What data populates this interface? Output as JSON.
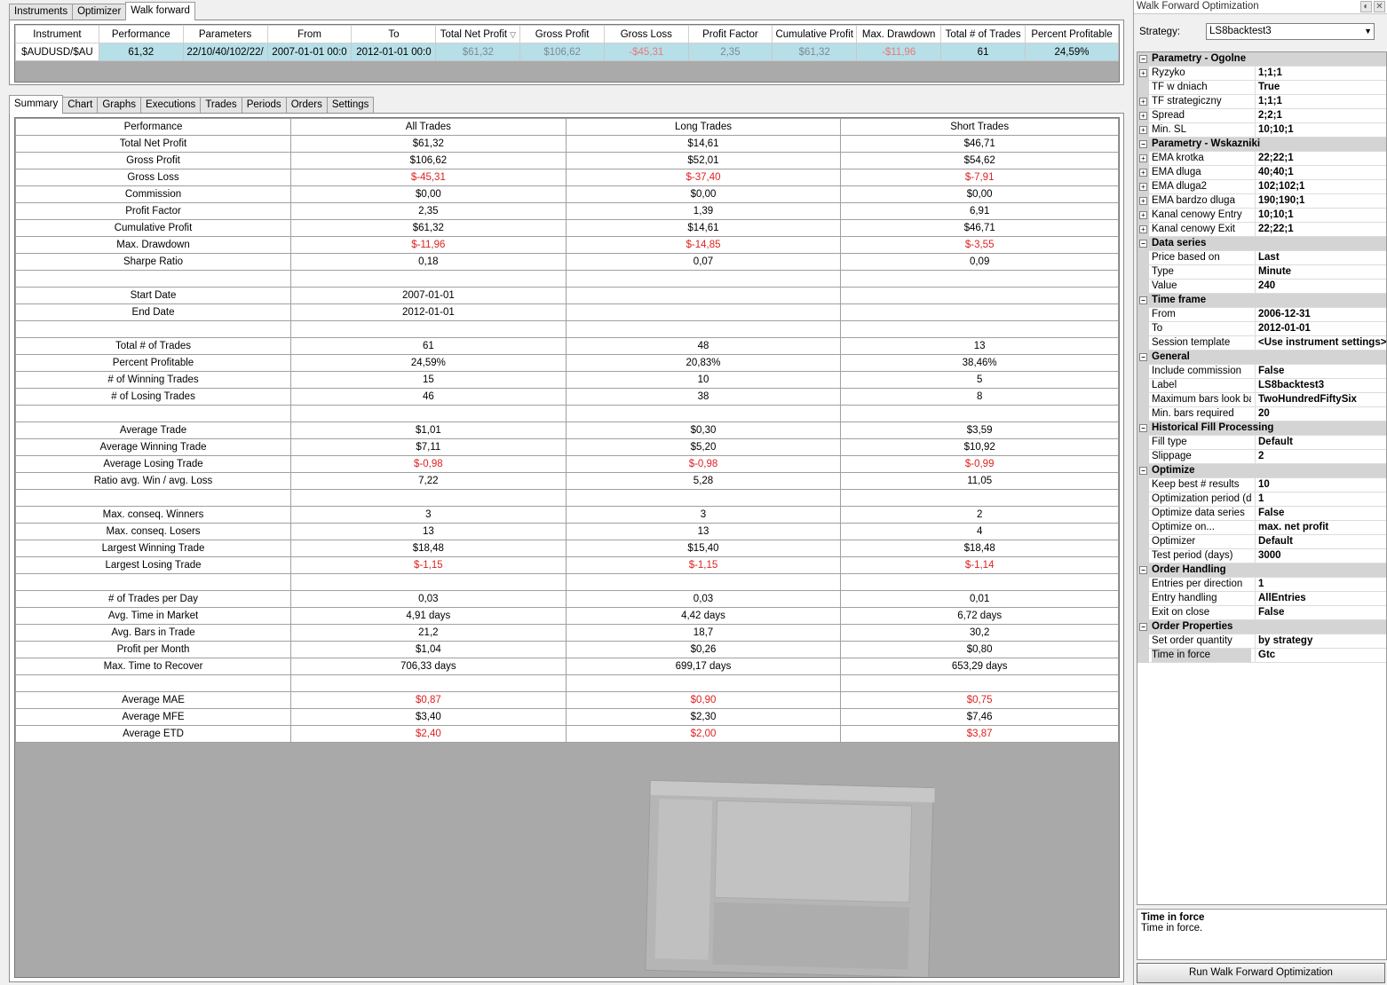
{
  "top_tabs": [
    "Instruments",
    "Optimizer",
    "Walk forward"
  ],
  "top_grid": {
    "headers": [
      "Instrument",
      "Performance",
      "Parameters",
      "From",
      "To",
      "Total Net Profit",
      "Gross Profit",
      "Gross Loss",
      "Profit Factor",
      "Cumulative Profit",
      "Max. Drawdown",
      "Total # of Trades",
      "Percent Profitable"
    ],
    "sort_indicator": "▽",
    "row": [
      "$AUDUSD/$AU",
      "61,32",
      "22/10/40/102/22/",
      "2007-01-01 00:0",
      "2012-01-01 00:0",
      "$61,32",
      "$106,62",
      "-$45,31",
      "2,35",
      "$61,32",
      "-$11,96",
      "61",
      "24,59%"
    ]
  },
  "lower_tabs": [
    "Summary",
    "Chart",
    "Graphs",
    "Executions",
    "Trades",
    "Periods",
    "Orders",
    "Settings"
  ],
  "summary": {
    "headers": [
      "Performance",
      "All Trades",
      "Long Trades",
      "Short Trades"
    ],
    "rows": [
      {
        "label": "Total Net Profit",
        "all": "$61,32",
        "long": "$14,61",
        "short": "$46,71"
      },
      {
        "label": "Gross Profit",
        "all": "$106,62",
        "long": "$52,01",
        "short": "$54,62"
      },
      {
        "label": "Gross Loss",
        "all": "$-45,31",
        "long": "$-37,40",
        "short": "$-7,91",
        "neg": true
      },
      {
        "label": "Commission",
        "all": "$0,00",
        "long": "$0,00",
        "short": "$0,00"
      },
      {
        "label": "Profit Factor",
        "all": "2,35",
        "long": "1,39",
        "short": "6,91"
      },
      {
        "label": "Cumulative Profit",
        "all": "$61,32",
        "long": "$14,61",
        "short": "$46,71"
      },
      {
        "label": "Max. Drawdown",
        "all": "$-11,96",
        "long": "$-14,85",
        "short": "$-3,55",
        "neg": true
      },
      {
        "label": "Sharpe Ratio",
        "all": "0,18",
        "long": "0,07",
        "short": "0,09"
      },
      {
        "label": "",
        "all": "",
        "long": "",
        "short": ""
      },
      {
        "label": "Start Date",
        "all": "2007-01-01",
        "long": "",
        "short": ""
      },
      {
        "label": "End Date",
        "all": "2012-01-01",
        "long": "",
        "short": ""
      },
      {
        "label": "",
        "all": "",
        "long": "",
        "short": ""
      },
      {
        "label": "Total # of Trades",
        "all": "61",
        "long": "48",
        "short": "13"
      },
      {
        "label": "Percent Profitable",
        "all": "24,59%",
        "long": "20,83%",
        "short": "38,46%"
      },
      {
        "label": "# of Winning Trades",
        "all": "15",
        "long": "10",
        "short": "5"
      },
      {
        "label": "# of Losing Trades",
        "all": "46",
        "long": "38",
        "short": "8"
      },
      {
        "label": "",
        "all": "",
        "long": "",
        "short": ""
      },
      {
        "label": "Average Trade",
        "all": "$1,01",
        "long": "$0,30",
        "short": "$3,59"
      },
      {
        "label": "Average Winning Trade",
        "all": "$7,11",
        "long": "$5,20",
        "short": "$10,92"
      },
      {
        "label": "Average Losing Trade",
        "all": "$-0,98",
        "long": "$-0,98",
        "short": "$-0,99",
        "neg": true
      },
      {
        "label": "Ratio avg. Win / avg. Loss",
        "all": "7,22",
        "long": "5,28",
        "short": "11,05"
      },
      {
        "label": "",
        "all": "",
        "long": "",
        "short": ""
      },
      {
        "label": "Max. conseq. Winners",
        "all": "3",
        "long": "3",
        "short": "2"
      },
      {
        "label": "Max. conseq. Losers",
        "all": "13",
        "long": "13",
        "short": "4"
      },
      {
        "label": "Largest Winning Trade",
        "all": "$18,48",
        "long": "$15,40",
        "short": "$18,48"
      },
      {
        "label": "Largest Losing Trade",
        "all": "$-1,15",
        "long": "$-1,15",
        "short": "$-1,14",
        "neg": true
      },
      {
        "label": "",
        "all": "",
        "long": "",
        "short": ""
      },
      {
        "label": "# of Trades per Day",
        "all": "0,03",
        "long": "0,03",
        "short": "0,01"
      },
      {
        "label": "Avg. Time in Market",
        "all": "4,91 days",
        "long": "4,42 days",
        "short": "6,72 days"
      },
      {
        "label": "Avg. Bars in Trade",
        "all": "21,2",
        "long": "18,7",
        "short": "30,2"
      },
      {
        "label": "Profit per Month",
        "all": "$1,04",
        "long": "$0,26",
        "short": "$0,80"
      },
      {
        "label": "Max. Time to Recover",
        "all": "706,33 days",
        "long": "699,17 days",
        "short": "653,29 days"
      },
      {
        "label": "",
        "all": "",
        "long": "",
        "short": ""
      },
      {
        "label": "Average MAE",
        "all": "$0,87",
        "long": "$0,90",
        "short": "$0,75",
        "neg": true
      },
      {
        "label": "Average MFE",
        "all": "$3,40",
        "long": "$2,30",
        "short": "$7,46"
      },
      {
        "label": "Average ETD",
        "all": "$2,40",
        "long": "$2,00",
        "short": "$3,87",
        "neg": true
      }
    ]
  },
  "right_panel": {
    "title": "Walk Forward Optimization",
    "strategy_label": "Strategy:",
    "strategy_value": "LS8backtest3",
    "properties": [
      {
        "type": "cat",
        "name": "Parametry - Ogolne"
      },
      {
        "type": "prop",
        "name": "Ryzyko",
        "value": "1;1;1",
        "expandable": true
      },
      {
        "type": "prop",
        "name": "TF w dniach",
        "value": "True"
      },
      {
        "type": "prop",
        "name": "TF strategiczny",
        "value": "1;1;1",
        "expandable": true
      },
      {
        "type": "prop",
        "name": "Spread",
        "value": "2;2;1",
        "expandable": true
      },
      {
        "type": "prop",
        "name": "Min. SL",
        "value": "10;10;1",
        "expandable": true
      },
      {
        "type": "cat",
        "name": "Parametry - Wskazniki"
      },
      {
        "type": "prop",
        "name": "EMA krotka",
        "value": "22;22;1",
        "expandable": true
      },
      {
        "type": "prop",
        "name": "EMA dluga",
        "value": "40;40;1",
        "expandable": true
      },
      {
        "type": "prop",
        "name": "EMA dluga2",
        "value": "102;102;1",
        "expandable": true
      },
      {
        "type": "prop",
        "name": "EMA bardzo dluga",
        "value": "190;190;1",
        "expandable": true
      },
      {
        "type": "prop",
        "name": "Kanal cenowy Entry",
        "value": "10;10;1",
        "expandable": true
      },
      {
        "type": "prop",
        "name": "Kanal cenowy Exit",
        "value": "22;22;1",
        "expandable": true
      },
      {
        "type": "cat",
        "name": "Data series"
      },
      {
        "type": "prop",
        "name": "Price based on",
        "value": "Last"
      },
      {
        "type": "prop",
        "name": "Type",
        "value": "Minute"
      },
      {
        "type": "prop",
        "name": "Value",
        "value": "240"
      },
      {
        "type": "cat",
        "name": "Time frame"
      },
      {
        "type": "prop",
        "name": "From",
        "value": "2006-12-31"
      },
      {
        "type": "prop",
        "name": "To",
        "value": "2012-01-01"
      },
      {
        "type": "prop",
        "name": "Session template",
        "value": "<Use instrument settings>"
      },
      {
        "type": "cat",
        "name": "General"
      },
      {
        "type": "prop",
        "name": "Include commission",
        "value": "False"
      },
      {
        "type": "prop",
        "name": "Label",
        "value": "LS8backtest3"
      },
      {
        "type": "prop",
        "name": "Maximum bars look bac",
        "value": "TwoHundredFiftySix"
      },
      {
        "type": "prop",
        "name": "Min. bars required",
        "value": "20"
      },
      {
        "type": "cat",
        "name": "Historical Fill Processing"
      },
      {
        "type": "prop",
        "name": "Fill type",
        "value": "Default"
      },
      {
        "type": "prop",
        "name": "Slippage",
        "value": "2"
      },
      {
        "type": "cat",
        "name": "Optimize"
      },
      {
        "type": "prop",
        "name": "Keep best # results",
        "value": "10"
      },
      {
        "type": "prop",
        "name": "Optimization period (da",
        "value": "1"
      },
      {
        "type": "prop",
        "name": "Optimize data series",
        "value": "False"
      },
      {
        "type": "prop",
        "name": "Optimize on...",
        "value": "max. net profit"
      },
      {
        "type": "prop",
        "name": "Optimizer",
        "value": "Default"
      },
      {
        "type": "prop",
        "name": "Test period (days)",
        "value": "3000"
      },
      {
        "type": "cat",
        "name": "Order Handling"
      },
      {
        "type": "prop",
        "name": "Entries per direction",
        "value": "1"
      },
      {
        "type": "prop",
        "name": "Entry handling",
        "value": "AllEntries"
      },
      {
        "type": "prop",
        "name": "Exit on close",
        "value": "False"
      },
      {
        "type": "cat",
        "name": "Order Properties"
      },
      {
        "type": "prop",
        "name": "Set order quantity",
        "value": "by strategy"
      },
      {
        "type": "prop",
        "name": "Time in force",
        "value": "Gtc",
        "selected": true
      }
    ],
    "help_title": "Time in force",
    "help_text": "Time in force.",
    "run_button": "Run Walk Forward Optimization"
  }
}
